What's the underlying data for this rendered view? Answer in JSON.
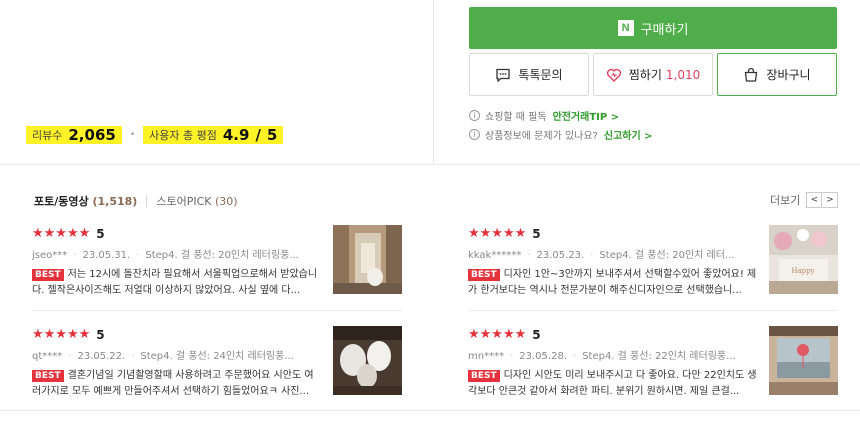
{
  "rating": {
    "review_label": "리뷰수",
    "review_count": "2,065",
    "score_label": "사용자 총 평점",
    "score": "4.9",
    "slash": "/",
    "max": "5"
  },
  "buy_button": {
    "logo": "N",
    "label": "구매하기"
  },
  "buttons": {
    "talk_label": "톡톡문의",
    "wish_label": "찜하기",
    "wish_count": "1,010",
    "cart_label": "장바구니"
  },
  "info": {
    "line1_text": "쇼핑할 때 필독",
    "line1_link": "안전거래TIP >",
    "line2_text": "상품정보에 문제가 있나요?",
    "line2_link": "신고하기 >"
  },
  "tabs": {
    "photo_label": "포토/동영상",
    "photo_count": "(1,518)",
    "pick_label": "스토어PICK",
    "pick_count": "(30)"
  },
  "more": {
    "label": "더보기",
    "prev": "<",
    "next": ">"
  },
  "reviews": [
    {
      "stars": "★★★★★",
      "score": "5",
      "user": "jseo***",
      "date": "23.05.31.",
      "option": "Step4. 걸 풍선: 20인치 레터링풍...",
      "badge": "BEST",
      "text": "저는 12시에 돌잔치라 필요해서 서울픽업으로해서 받았습니다. 젤작은사이즈해도 저얼대 이상하지 않았어요. 사실 옆에 다..."
    },
    {
      "stars": "★★★★★",
      "score": "5",
      "user": "kkak******",
      "date": "23.05.23.",
      "option": "Step4. 걸 풍선: 20인치 레터...",
      "badge": "BEST",
      "text": "디자인 1안~3안까지 보내주셔서 선택할수있어 좋았어요! 제가 한거보다는 역시나 전문가분이 해주신디자인으로 선택했습니..."
    },
    {
      "stars": "★★★★★",
      "score": "5",
      "user": "qt****",
      "date": "23.05.22.",
      "option": "Step4. 걸 풍선: 24인치 레터링풍...",
      "badge": "BEST",
      "text": "결혼기념일 기념촬영할때 사용하려고 주문했어요 시안도 여러가지로 모두 예쁘게 만들어주셔서 선택하기 힘들었어요ㅋ 사진..."
    },
    {
      "stars": "★★★★★",
      "score": "5",
      "user": "mn****",
      "date": "23.05.28.",
      "option": "Step4. 걸 풍선: 22인치 레터링풍...",
      "badge": "BEST",
      "text": "디자인 시안도 미리 보내주시고 다 좋아요. 다만 22인치도 생각보다 안큰것 같아서 화려한 파티. 분위기 원하시면. 제일 큰걸..."
    }
  ]
}
